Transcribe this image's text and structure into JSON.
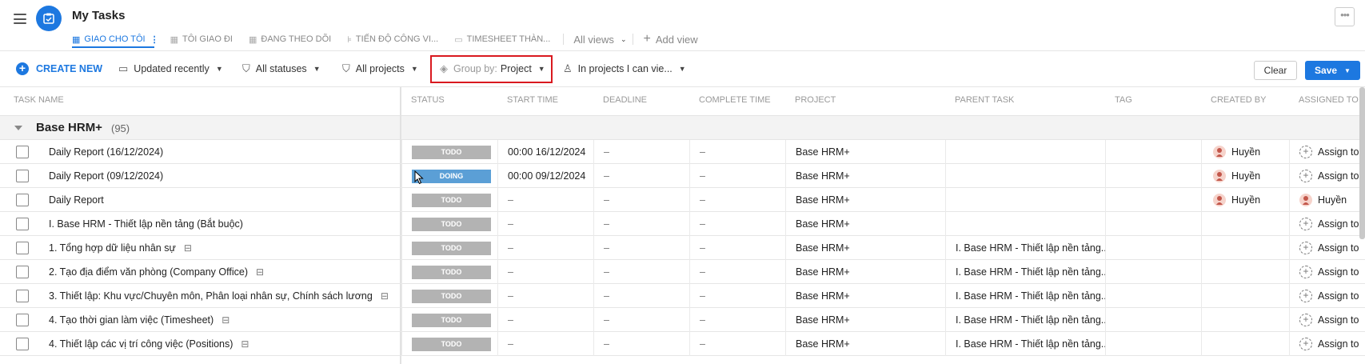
{
  "header": {
    "title": "My Tasks",
    "tabs": [
      {
        "label": "GIAO CHO TÔI",
        "active": true,
        "icon": "table-icon"
      },
      {
        "label": "TÔI GIAO ĐI",
        "active": false,
        "icon": "table-icon"
      },
      {
        "label": "ĐANG THEO DÕI",
        "active": false,
        "icon": "table-icon"
      },
      {
        "label": "TIẾN ĐỘ CÔNG VI...",
        "active": false,
        "icon": "gantt-icon"
      },
      {
        "label": "TIMESHEET THÀN...",
        "active": false,
        "icon": "calendar-icon"
      }
    ],
    "all_views": "All views",
    "add_view": "Add view",
    "more": "•••"
  },
  "toolbar": {
    "create_new": "CREATE NEW",
    "sort": "Updated recently",
    "status_filter": "All statuses",
    "project_filter": "All projects",
    "group_by_label": "Group by:",
    "group_by_value": "Project",
    "scope": "In projects I can vie...",
    "clear": "Clear",
    "save": "Save"
  },
  "columns": {
    "task_name": "TASK NAME",
    "status": "STATUS",
    "start_time": "START TIME",
    "deadline": "DEADLINE",
    "complete_time": "COMPLETE TIME",
    "project": "PROJECT",
    "parent_task": "PARENT TASK",
    "tag": "TAG",
    "created_by": "CREATED BY",
    "assigned_to": "ASSIGNED TO"
  },
  "group": {
    "name": "Base HRM+",
    "count": "(95)"
  },
  "rows": [
    {
      "name": "Daily Report (16/12/2024)",
      "subtask": false,
      "status": "TODO",
      "start": "00:00 16/12/2024",
      "deadline": "–",
      "complete": "–",
      "project": "Base HRM+",
      "parent": "",
      "created_by": "Huyền",
      "assigned": "Assign to"
    },
    {
      "name": "Daily Report (09/12/2024)",
      "subtask": false,
      "status": "DOING",
      "start": "00:00 09/12/2024",
      "deadline": "–",
      "complete": "–",
      "project": "Base HRM+",
      "parent": "",
      "created_by": "Huyền",
      "assigned": "Assign to"
    },
    {
      "name": "Daily Report",
      "subtask": false,
      "status": "TODO",
      "start": "–",
      "deadline": "–",
      "complete": "–",
      "project": "Base HRM+",
      "parent": "",
      "created_by": "Huyền",
      "assigned": "Huyền"
    },
    {
      "name": "I. Base HRM - Thiết lập nền tảng (Bắt buộc)",
      "subtask": false,
      "status": "TODO",
      "start": "–",
      "deadline": "–",
      "complete": "–",
      "project": "Base HRM+",
      "parent": "",
      "created_by": "",
      "assigned": "Assign to"
    },
    {
      "name": "1. Tổng hợp dữ liệu nhân sự",
      "subtask": true,
      "status": "TODO",
      "start": "–",
      "deadline": "–",
      "complete": "–",
      "project": "Base HRM+",
      "parent": "I. Base HRM - Thiết lập nền tảng...",
      "created_by": "",
      "assigned": "Assign to"
    },
    {
      "name": "2. Tạo địa điểm văn phòng (Company Office)",
      "subtask": true,
      "status": "TODO",
      "start": "–",
      "deadline": "–",
      "complete": "–",
      "project": "Base HRM+",
      "parent": "I. Base HRM - Thiết lập nền tảng...",
      "created_by": "",
      "assigned": "Assign to"
    },
    {
      "name": "3. Thiết lập: Khu vực/Chuyên môn, Phân loại nhân sự, Chính sách lương",
      "subtask": true,
      "status": "TODO",
      "start": "–",
      "deadline": "–",
      "complete": "–",
      "project": "Base HRM+",
      "parent": "I. Base HRM - Thiết lập nền tảng...",
      "created_by": "",
      "assigned": "Assign to"
    },
    {
      "name": "4. Tạo thời gian làm việc (Timesheet)",
      "subtask": true,
      "status": "TODO",
      "start": "–",
      "deadline": "–",
      "complete": "–",
      "project": "Base HRM+",
      "parent": "I. Base HRM - Thiết lập nền tảng...",
      "created_by": "",
      "assigned": "Assign to"
    },
    {
      "name": "4. Thiết lập các vị trí công việc (Positions)",
      "subtask": true,
      "status": "TODO",
      "start": "–",
      "deadline": "–",
      "complete": "–",
      "project": "Base HRM+",
      "parent": "I. Base HRM - Thiết lập nền tảng...",
      "created_by": "",
      "assigned": "Assign to"
    }
  ],
  "colors": {
    "accent": "#1d78e0",
    "todo": "#b3b3b3",
    "doing": "#5b9fd6",
    "highlight_box": "#d9191f"
  }
}
